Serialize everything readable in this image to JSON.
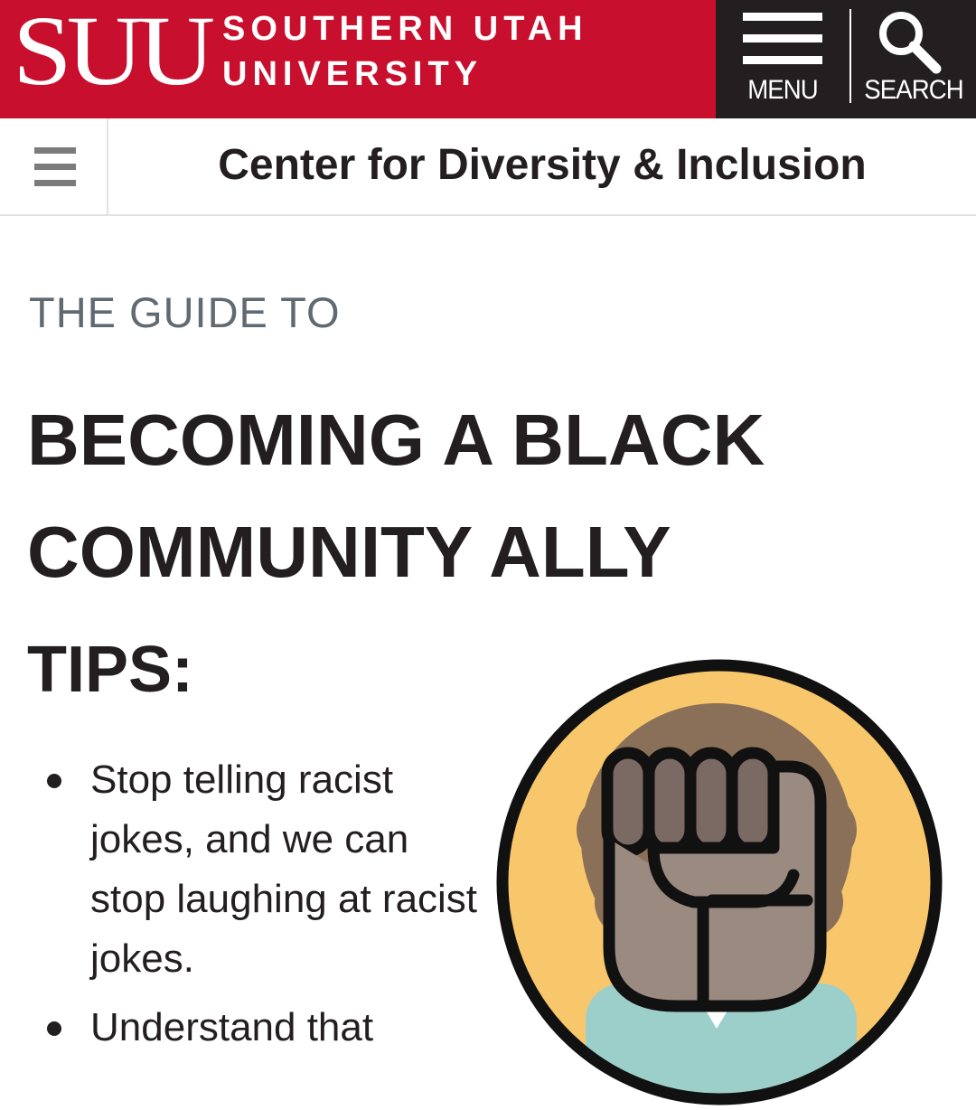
{
  "header": {
    "logo_mark": "SUU",
    "logo_line1": "SOUTHERN UTAH",
    "logo_line2": "UNIVERSITY",
    "menu_label": "MENU",
    "search_label": "SEARCH",
    "brand_color": "#c8102e",
    "nav_bg_color": "#231f20"
  },
  "subheader": {
    "title": "Center for Diversity & Inclusion",
    "toggle_icon": "hamburger-icon"
  },
  "main": {
    "eyebrow": "THE GUIDE TO",
    "headline_line1": "BECOMING A BLACK",
    "headline_line2": "COMMUNITY ALLY",
    "tips_title": "TIPS:",
    "tips": [
      "Stop telling racist jokes, and we can stop laughing at racist jokes.",
      "Understand that"
    ],
    "illustration_icon": "raised-fist-icon",
    "illustration_bg_color": "#f8c76c"
  }
}
